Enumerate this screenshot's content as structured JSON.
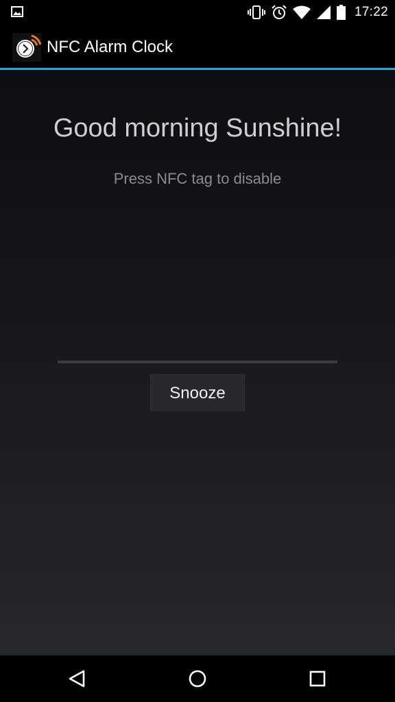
{
  "status_bar": {
    "time": "17:22",
    "icons": [
      "image-notification-icon",
      "vibrate-icon",
      "alarm-icon",
      "wifi-icon",
      "cell-signal-icon",
      "battery-icon"
    ]
  },
  "action_bar": {
    "title": "NFC Alarm Clock",
    "icon": "alarm-clock-nfc-icon"
  },
  "alarm": {
    "greeting": "Good morning Sunshine!",
    "hint": "Press NFC tag to disable",
    "progress_fraction": 0,
    "snooze_label": "Snooze"
  },
  "navigation": {
    "items": [
      "back-icon",
      "home-icon",
      "recents-icon"
    ]
  },
  "colors": {
    "accent": "#33a3d1",
    "brand_orange": "#f07a1c",
    "background": "#000000"
  }
}
